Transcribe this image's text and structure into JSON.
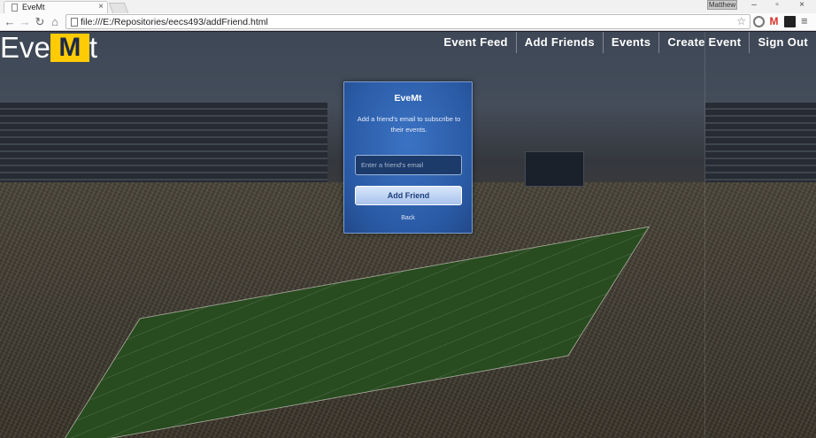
{
  "browser": {
    "tab_title": "EveMt",
    "tab_close": "×",
    "profile_name": "Matthew",
    "url": "file:///E:/Repositories/eecs493/addFriend.html",
    "window_controls": [
      "–",
      "▫",
      "×"
    ],
    "nav_glyphs": {
      "back": "←",
      "forward": "→",
      "reload": "↻",
      "home": "⌂",
      "star": "☆",
      "menu": "≡",
      "ext_gmail": "M"
    }
  },
  "header": {
    "logo_prefix": "Eve",
    "logo_m": "M",
    "logo_suffix": "t",
    "nav": [
      {
        "label": "Event Feed"
      },
      {
        "label": "Add Friends"
      },
      {
        "label": "Events"
      },
      {
        "label": "Create Event"
      },
      {
        "label": "Sign Out"
      }
    ]
  },
  "card": {
    "title": "EveMt",
    "description": "Add a friend's email to subscribe to their events.",
    "email_placeholder": "Enter a friend's email",
    "submit_label": "Add Friend",
    "back_label": "Back"
  },
  "colors": {
    "brand_maize": "#ffcb05",
    "brand_blue": "#1b2a4a",
    "card_blue": "#2a5aa4"
  }
}
